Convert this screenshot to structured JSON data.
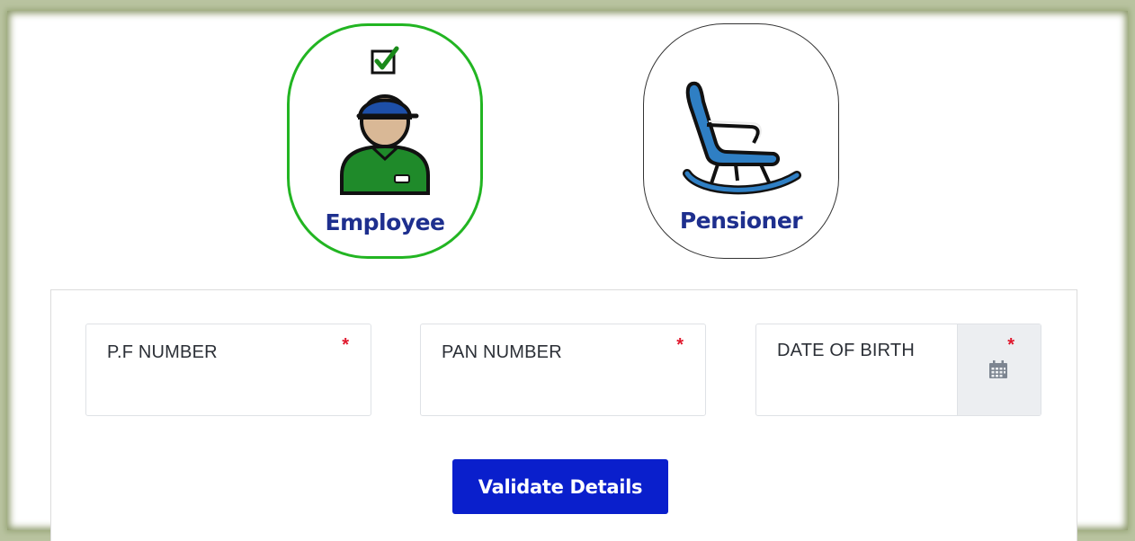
{
  "role_selector": {
    "selected": "employee",
    "employee": {
      "label": "Employee",
      "icon": "employee-person-icon",
      "checked_icon": "checkbox-checked-icon",
      "border_color": "#22b522"
    },
    "pensioner": {
      "label": "Pensioner",
      "icon": "rocking-chair-icon",
      "border_color": "#333333"
    }
  },
  "form": {
    "fields": {
      "pf_number": {
        "label": "P.F NUMBER",
        "required_mark": "*",
        "value": ""
      },
      "pan_number": {
        "label": "PAN NUMBER",
        "required_mark": "*",
        "value": ""
      },
      "date_of_birth": {
        "label": "DATE OF BIRTH",
        "required_mark": "*",
        "value": "",
        "icon": "calendar-icon"
      }
    },
    "submit_label": "Validate Details"
  },
  "colors": {
    "label_blue": "#1e2f8e",
    "button_blue": "#0a1fcc",
    "required_red": "#e0182d",
    "selected_green": "#22b522"
  }
}
